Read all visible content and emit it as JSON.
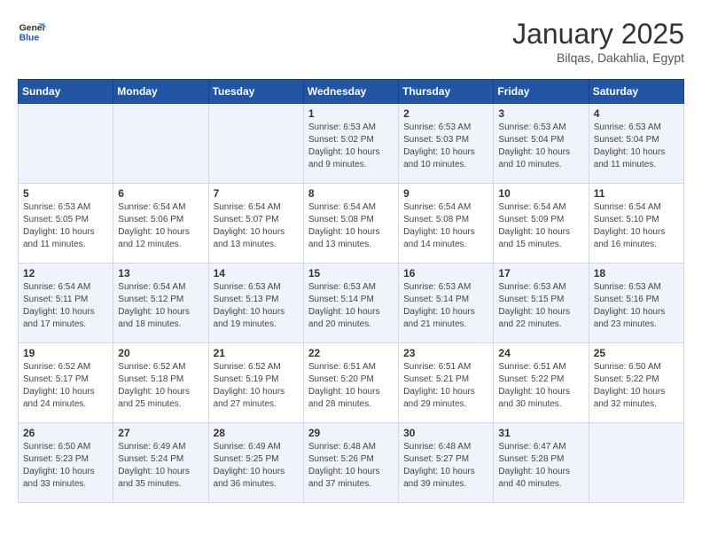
{
  "header": {
    "logo_line1": "General",
    "logo_line2": "Blue",
    "title": "January 2025",
    "subtitle": "Bilqas, Dakahlia, Egypt"
  },
  "days_of_week": [
    "Sunday",
    "Monday",
    "Tuesday",
    "Wednesday",
    "Thursday",
    "Friday",
    "Saturday"
  ],
  "weeks": [
    [
      {
        "day": "",
        "info": ""
      },
      {
        "day": "",
        "info": ""
      },
      {
        "day": "",
        "info": ""
      },
      {
        "day": "1",
        "info": "Sunrise: 6:53 AM\nSunset: 5:02 PM\nDaylight: 10 hours\nand 9 minutes."
      },
      {
        "day": "2",
        "info": "Sunrise: 6:53 AM\nSunset: 5:03 PM\nDaylight: 10 hours\nand 10 minutes."
      },
      {
        "day": "3",
        "info": "Sunrise: 6:53 AM\nSunset: 5:04 PM\nDaylight: 10 hours\nand 10 minutes."
      },
      {
        "day": "4",
        "info": "Sunrise: 6:53 AM\nSunset: 5:04 PM\nDaylight: 10 hours\nand 11 minutes."
      }
    ],
    [
      {
        "day": "5",
        "info": "Sunrise: 6:53 AM\nSunset: 5:05 PM\nDaylight: 10 hours\nand 11 minutes."
      },
      {
        "day": "6",
        "info": "Sunrise: 6:54 AM\nSunset: 5:06 PM\nDaylight: 10 hours\nand 12 minutes."
      },
      {
        "day": "7",
        "info": "Sunrise: 6:54 AM\nSunset: 5:07 PM\nDaylight: 10 hours\nand 13 minutes."
      },
      {
        "day": "8",
        "info": "Sunrise: 6:54 AM\nSunset: 5:08 PM\nDaylight: 10 hours\nand 13 minutes."
      },
      {
        "day": "9",
        "info": "Sunrise: 6:54 AM\nSunset: 5:08 PM\nDaylight: 10 hours\nand 14 minutes."
      },
      {
        "day": "10",
        "info": "Sunrise: 6:54 AM\nSunset: 5:09 PM\nDaylight: 10 hours\nand 15 minutes."
      },
      {
        "day": "11",
        "info": "Sunrise: 6:54 AM\nSunset: 5:10 PM\nDaylight: 10 hours\nand 16 minutes."
      }
    ],
    [
      {
        "day": "12",
        "info": "Sunrise: 6:54 AM\nSunset: 5:11 PM\nDaylight: 10 hours\nand 17 minutes."
      },
      {
        "day": "13",
        "info": "Sunrise: 6:54 AM\nSunset: 5:12 PM\nDaylight: 10 hours\nand 18 minutes."
      },
      {
        "day": "14",
        "info": "Sunrise: 6:53 AM\nSunset: 5:13 PM\nDaylight: 10 hours\nand 19 minutes."
      },
      {
        "day": "15",
        "info": "Sunrise: 6:53 AM\nSunset: 5:14 PM\nDaylight: 10 hours\nand 20 minutes."
      },
      {
        "day": "16",
        "info": "Sunrise: 6:53 AM\nSunset: 5:14 PM\nDaylight: 10 hours\nand 21 minutes."
      },
      {
        "day": "17",
        "info": "Sunrise: 6:53 AM\nSunset: 5:15 PM\nDaylight: 10 hours\nand 22 minutes."
      },
      {
        "day": "18",
        "info": "Sunrise: 6:53 AM\nSunset: 5:16 PM\nDaylight: 10 hours\nand 23 minutes."
      }
    ],
    [
      {
        "day": "19",
        "info": "Sunrise: 6:52 AM\nSunset: 5:17 PM\nDaylight: 10 hours\nand 24 minutes."
      },
      {
        "day": "20",
        "info": "Sunrise: 6:52 AM\nSunset: 5:18 PM\nDaylight: 10 hours\nand 25 minutes."
      },
      {
        "day": "21",
        "info": "Sunrise: 6:52 AM\nSunset: 5:19 PM\nDaylight: 10 hours\nand 27 minutes."
      },
      {
        "day": "22",
        "info": "Sunrise: 6:51 AM\nSunset: 5:20 PM\nDaylight: 10 hours\nand 28 minutes."
      },
      {
        "day": "23",
        "info": "Sunrise: 6:51 AM\nSunset: 5:21 PM\nDaylight: 10 hours\nand 29 minutes."
      },
      {
        "day": "24",
        "info": "Sunrise: 6:51 AM\nSunset: 5:22 PM\nDaylight: 10 hours\nand 30 minutes."
      },
      {
        "day": "25",
        "info": "Sunrise: 6:50 AM\nSunset: 5:22 PM\nDaylight: 10 hours\nand 32 minutes."
      }
    ],
    [
      {
        "day": "26",
        "info": "Sunrise: 6:50 AM\nSunset: 5:23 PM\nDaylight: 10 hours\nand 33 minutes."
      },
      {
        "day": "27",
        "info": "Sunrise: 6:49 AM\nSunset: 5:24 PM\nDaylight: 10 hours\nand 35 minutes."
      },
      {
        "day": "28",
        "info": "Sunrise: 6:49 AM\nSunset: 5:25 PM\nDaylight: 10 hours\nand 36 minutes."
      },
      {
        "day": "29",
        "info": "Sunrise: 6:48 AM\nSunset: 5:26 PM\nDaylight: 10 hours\nand 37 minutes."
      },
      {
        "day": "30",
        "info": "Sunrise: 6:48 AM\nSunset: 5:27 PM\nDaylight: 10 hours\nand 39 minutes."
      },
      {
        "day": "31",
        "info": "Sunrise: 6:47 AM\nSunset: 5:28 PM\nDaylight: 10 hours\nand 40 minutes."
      },
      {
        "day": "",
        "info": ""
      }
    ]
  ]
}
